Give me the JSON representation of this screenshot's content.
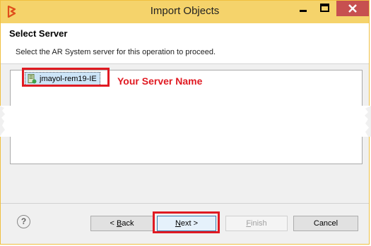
{
  "window": {
    "title": "Import Objects"
  },
  "header": {
    "title": "Select Server",
    "description": "Select the AR System server for this operation to proceed."
  },
  "servers": [
    {
      "label": "jmayol-rem19-IE",
      "selected": true
    }
  ],
  "annotation": {
    "text": "Your Server Name",
    "color": "#e01a22"
  },
  "footer": {
    "help_label": "?",
    "back": {
      "mnemonic": "B",
      "rest": "ack",
      "prefix": "< "
    },
    "next": {
      "mnemonic": "N",
      "rest": "ext >"
    },
    "finish": {
      "mnemonic": "F",
      "rest": "inish",
      "enabled": false
    },
    "cancel_label": "Cancel"
  },
  "colors": {
    "titlebar": "#f5d36b",
    "close": "#c75050",
    "highlight": "#e01a22"
  },
  "icons": [
    "app-logo-icon",
    "minimize-icon",
    "maximize-icon",
    "close-icon",
    "server-icon",
    "help-icon"
  ]
}
